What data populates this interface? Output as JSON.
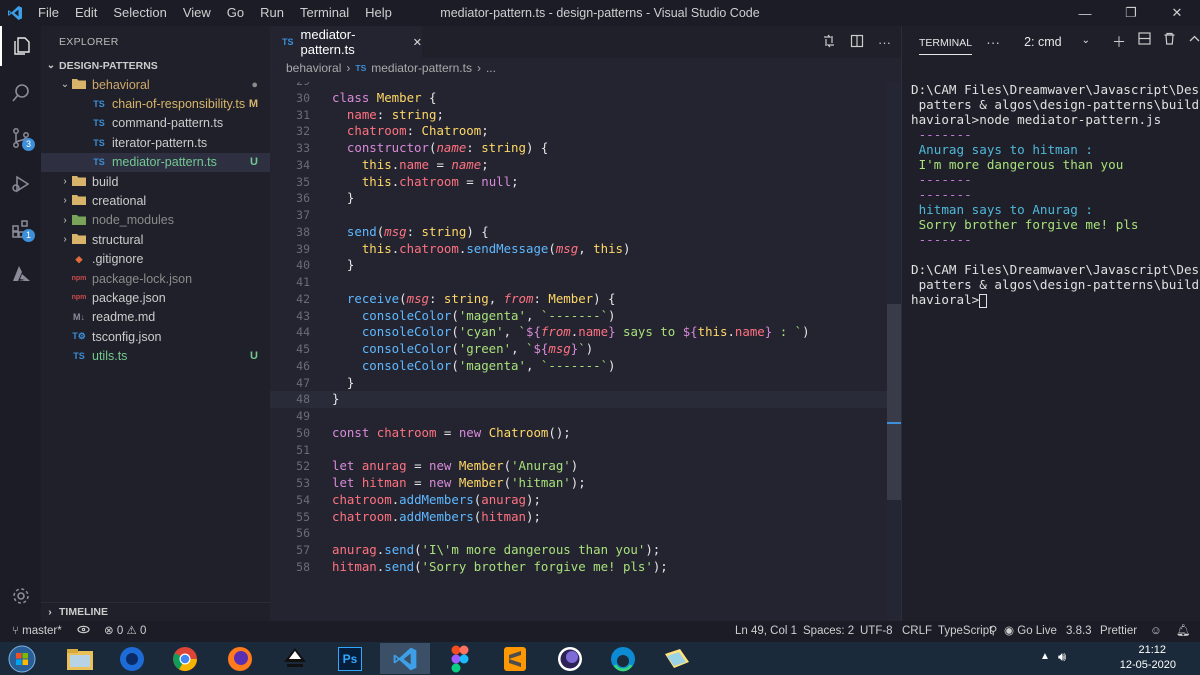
{
  "titlebar": {
    "menus": [
      "File",
      "Edit",
      "Selection",
      "View",
      "Go",
      "Run",
      "Terminal",
      "Help"
    ],
    "title": "mediator-pattern.ts - design-patterns - Visual Studio Code",
    "controls": [
      "—",
      "❐",
      "✕"
    ]
  },
  "activity": {
    "scm_badge": "3",
    "extensions_badge": "1"
  },
  "explorer": {
    "title": "EXPLORER",
    "project": "DESIGN-PATTERNS",
    "items": [
      {
        "label": "behavioral",
        "kind": "folder-open",
        "status": "●",
        "status_color": "#8b8b8b",
        "color": "#cfa86b"
      },
      {
        "label": "chain-of-responsibility.ts",
        "kind": "ts",
        "status": "M",
        "status_color": "#d7b46a",
        "color": "#d7b46a"
      },
      {
        "label": "command-pattern.ts",
        "kind": "ts",
        "status": "",
        "status_color": "#cccccc",
        "color": "#cccccc"
      },
      {
        "label": "iterator-pattern.ts",
        "kind": "ts",
        "status": "",
        "status_color": "#cccccc",
        "color": "#cccccc"
      },
      {
        "label": "mediator-pattern.ts",
        "kind": "ts",
        "status": "U",
        "status_color": "#73c991",
        "color": "#73c991"
      },
      {
        "label": "build",
        "kind": "folder",
        "status": "",
        "status_color": "#cccccc",
        "color": "#cccccc"
      },
      {
        "label": "creational",
        "kind": "folder",
        "status": "",
        "status_color": "#cccccc",
        "color": "#cccccc"
      },
      {
        "label": "node_modules",
        "kind": "folder-node",
        "status": "",
        "status_color": "#8b8b8b",
        "color": "#8b8b8b"
      },
      {
        "label": "structural",
        "kind": "folder",
        "status": "",
        "status_color": "#cccccc",
        "color": "#cccccc"
      },
      {
        "label": ".gitignore",
        "kind": "git",
        "status": "",
        "status_color": "#cccccc",
        "color": "#cccccc"
      },
      {
        "label": "package-lock.json",
        "kind": "npm",
        "status": "",
        "status_color": "#8b8b8b",
        "color": "#8b8b8b"
      },
      {
        "label": "package.json",
        "kind": "npm",
        "status": "",
        "status_color": "#cccccc",
        "color": "#cccccc"
      },
      {
        "label": "readme.md",
        "kind": "md",
        "status": "",
        "status_color": "#cccccc",
        "color": "#cccccc"
      },
      {
        "label": "tsconfig.json",
        "kind": "tsconfig",
        "status": "",
        "status_color": "#cccccc",
        "color": "#cccccc"
      },
      {
        "label": "utils.ts",
        "kind": "ts",
        "status": "U",
        "status_color": "#73c991",
        "color": "#73c991"
      }
    ],
    "timeline": "TIMELINE"
  },
  "editor": {
    "tab_icon": "TS",
    "tab_label": "mediator-pattern.ts",
    "tab_close": "✕",
    "breadcrumb": [
      "behavioral",
      "mediator-pattern.ts",
      "..."
    ],
    "breadcrumb_ts": "TS",
    "first_line": 29,
    "current_line": 48,
    "lines": [
      [],
      [
        [
          "k",
          "class "
        ],
        [
          "c",
          "Member "
        ],
        [
          "d",
          "{"
        ]
      ],
      [
        [
          "d",
          "  "
        ],
        [
          "p",
          "name"
        ],
        [
          "d",
          ": "
        ],
        [
          "t",
          "string"
        ],
        [
          "d",
          ";"
        ]
      ],
      [
        [
          "d",
          "  "
        ],
        [
          "p",
          "chatroom"
        ],
        [
          "d",
          ": "
        ],
        [
          "t",
          "Chatroom"
        ],
        [
          "d",
          ";"
        ]
      ],
      [
        [
          "d",
          "  "
        ],
        [
          "k",
          "constructor"
        ],
        [
          "d",
          "("
        ],
        [
          "pi",
          "name"
        ],
        [
          "d",
          ": "
        ],
        [
          "t",
          "string"
        ],
        [
          "d",
          ") {"
        ]
      ],
      [
        [
          "d",
          "    "
        ],
        [
          "th",
          "this"
        ],
        [
          "d",
          "."
        ],
        [
          "p",
          "name"
        ],
        [
          "d",
          " = "
        ],
        [
          "pi",
          "name"
        ],
        [
          "d",
          ";"
        ]
      ],
      [
        [
          "d",
          "    "
        ],
        [
          "th",
          "this"
        ],
        [
          "d",
          "."
        ],
        [
          "p",
          "chatroom"
        ],
        [
          "d",
          " = "
        ],
        [
          "k",
          "null"
        ],
        [
          "d",
          ";"
        ]
      ],
      [
        [
          "d",
          "  }"
        ]
      ],
      [],
      [
        [
          "d",
          "  "
        ],
        [
          "f",
          "send"
        ],
        [
          "d",
          "("
        ],
        [
          "pi",
          "msg"
        ],
        [
          "d",
          ": "
        ],
        [
          "t",
          "string"
        ],
        [
          "d",
          ") {"
        ]
      ],
      [
        [
          "d",
          "    "
        ],
        [
          "th",
          "this"
        ],
        [
          "d",
          "."
        ],
        [
          "p",
          "chatroom"
        ],
        [
          "d",
          "."
        ],
        [
          "f",
          "sendMessage"
        ],
        [
          "d",
          "("
        ],
        [
          "pi",
          "msg"
        ],
        [
          "d",
          ", "
        ],
        [
          "th",
          "this"
        ],
        [
          "d",
          ")"
        ]
      ],
      [
        [
          "d",
          "  }"
        ]
      ],
      [],
      [
        [
          "d",
          "  "
        ],
        [
          "f",
          "receive"
        ],
        [
          "d",
          "("
        ],
        [
          "pi",
          "msg"
        ],
        [
          "d",
          ": "
        ],
        [
          "t",
          "string"
        ],
        [
          "d",
          ", "
        ],
        [
          "pi",
          "from"
        ],
        [
          "d",
          ": "
        ],
        [
          "t",
          "Member"
        ],
        [
          "d",
          ") {"
        ]
      ],
      [
        [
          "d",
          "    "
        ],
        [
          "f",
          "consoleColor"
        ],
        [
          "d",
          "("
        ],
        [
          "s",
          "'magenta'"
        ],
        [
          "d",
          ", "
        ],
        [
          "s",
          "`-------`"
        ],
        [
          "d",
          ")"
        ]
      ],
      [
        [
          "d",
          "    "
        ],
        [
          "f",
          "consoleColor"
        ],
        [
          "d",
          "("
        ],
        [
          "s",
          "'cyan'"
        ],
        [
          "d",
          ", "
        ],
        [
          "s",
          "`"
        ],
        [
          "k",
          "${"
        ],
        [
          "pi",
          "from"
        ],
        [
          "d",
          "."
        ],
        [
          "p",
          "name"
        ],
        [
          "k",
          "}"
        ],
        [
          "s",
          " says to "
        ],
        [
          "k",
          "${"
        ],
        [
          "th",
          "this"
        ],
        [
          "d",
          "."
        ],
        [
          "p",
          "name"
        ],
        [
          "k",
          "}"
        ],
        [
          "s",
          " : `"
        ],
        [
          "d",
          ")"
        ]
      ],
      [
        [
          "d",
          "    "
        ],
        [
          "f",
          "consoleColor"
        ],
        [
          "d",
          "("
        ],
        [
          "s",
          "'green'"
        ],
        [
          "d",
          ", "
        ],
        [
          "s",
          "`"
        ],
        [
          "k",
          "${"
        ],
        [
          "pi",
          "msg"
        ],
        [
          "k",
          "}"
        ],
        [
          "s",
          "`"
        ],
        [
          "d",
          ")"
        ]
      ],
      [
        [
          "d",
          "    "
        ],
        [
          "f",
          "consoleColor"
        ],
        [
          "d",
          "("
        ],
        [
          "s",
          "'magenta'"
        ],
        [
          "d",
          ", "
        ],
        [
          "s",
          "`-------`"
        ],
        [
          "d",
          ")"
        ]
      ],
      [
        [
          "d",
          "  }"
        ]
      ],
      [
        [
          "d",
          "}"
        ]
      ],
      [],
      [
        [
          "k",
          "const "
        ],
        [
          "p",
          "chatroom"
        ],
        [
          "d",
          " = "
        ],
        [
          "k",
          "new "
        ],
        [
          "c",
          "Chatroom"
        ],
        [
          "d",
          "();"
        ]
      ],
      [],
      [
        [
          "k",
          "let "
        ],
        [
          "p",
          "anurag"
        ],
        [
          "d",
          " = "
        ],
        [
          "k",
          "new "
        ],
        [
          "c",
          "Member"
        ],
        [
          "d",
          "("
        ],
        [
          "s",
          "'Anurag'"
        ],
        [
          "d",
          ")"
        ]
      ],
      [
        [
          "k",
          "let "
        ],
        [
          "p",
          "hitman"
        ],
        [
          "d",
          " = "
        ],
        [
          "k",
          "new "
        ],
        [
          "c",
          "Member"
        ],
        [
          "d",
          "("
        ],
        [
          "s",
          "'hitman'"
        ],
        [
          "d",
          ");"
        ]
      ],
      [
        [
          "p",
          "chatroom"
        ],
        [
          "d",
          "."
        ],
        [
          "f",
          "addMembers"
        ],
        [
          "d",
          "("
        ],
        [
          "p",
          "anurag"
        ],
        [
          "d",
          ");"
        ]
      ],
      [
        [
          "p",
          "chatroom"
        ],
        [
          "d",
          "."
        ],
        [
          "f",
          "addMembers"
        ],
        [
          "d",
          "("
        ],
        [
          "p",
          "hitman"
        ],
        [
          "d",
          ");"
        ]
      ],
      [],
      [
        [
          "p",
          "anurag"
        ],
        [
          "d",
          "."
        ],
        [
          "f",
          "send"
        ],
        [
          "d",
          "("
        ],
        [
          "s",
          "'I\\'m more dangerous than you'"
        ],
        [
          "d",
          ");"
        ]
      ],
      [
        [
          "p",
          "hitman"
        ],
        [
          "d",
          "."
        ],
        [
          "f",
          "send"
        ],
        [
          "d",
          "("
        ],
        [
          "s",
          "'Sorry brother forgive me! pls'"
        ],
        [
          "d",
          ");"
        ]
      ]
    ]
  },
  "terminal": {
    "tab": "TERMINAL",
    "selected_shell": "2: cmd",
    "output": [
      {
        "text": "D:\\CAM Files\\Dreamwaver\\Javascript\\Design",
        "color": "default"
      },
      {
        "text": " patters & algos\\design-patterns\\build\\be",
        "color": "default"
      },
      {
        "text": "havioral>node mediator-pattern.js",
        "color": "default"
      },
      {
        "text": " -------",
        "color": "magenta"
      },
      {
        "text": " Anurag says to hitman :",
        "color": "cyan"
      },
      {
        "text": " I'm more dangerous than you",
        "color": "green"
      },
      {
        "text": " -------",
        "color": "magenta"
      },
      {
        "text": " -------",
        "color": "magenta"
      },
      {
        "text": " hitman says to Anurag :",
        "color": "cyan"
      },
      {
        "text": " Sorry brother forgive me! pls",
        "color": "green"
      },
      {
        "text": " -------",
        "color": "magenta"
      },
      {
        "text": "",
        "color": "default"
      },
      {
        "text": "D:\\CAM Files\\Dreamwaver\\Javascript\\Design",
        "color": "default"
      },
      {
        "text": " patters & algos\\design-patterns\\build\\be",
        "color": "default"
      },
      {
        "text": "havioral>",
        "color": "default",
        "cursor": true
      }
    ]
  },
  "statusbar": {
    "branch": "master*",
    "errors": "0",
    "warnings": "0",
    "position": "Ln 49, Col 1",
    "spaces": "Spaces: 2",
    "encoding": "UTF-8",
    "eol": "CRLF",
    "language": "TypeScript",
    "golive": "Go Live",
    "ts_version": "3.8.3",
    "prettier": "Prettier"
  },
  "taskbar": {
    "time": "21:12",
    "date": "12-05-2020",
    "ps_label": "Ps"
  },
  "colors": {
    "accent": "#3c8fd8",
    "editor_bg": "#232430",
    "sidebar_bg": "#1f2029",
    "taskbar_bg": "#1a2a3a"
  }
}
